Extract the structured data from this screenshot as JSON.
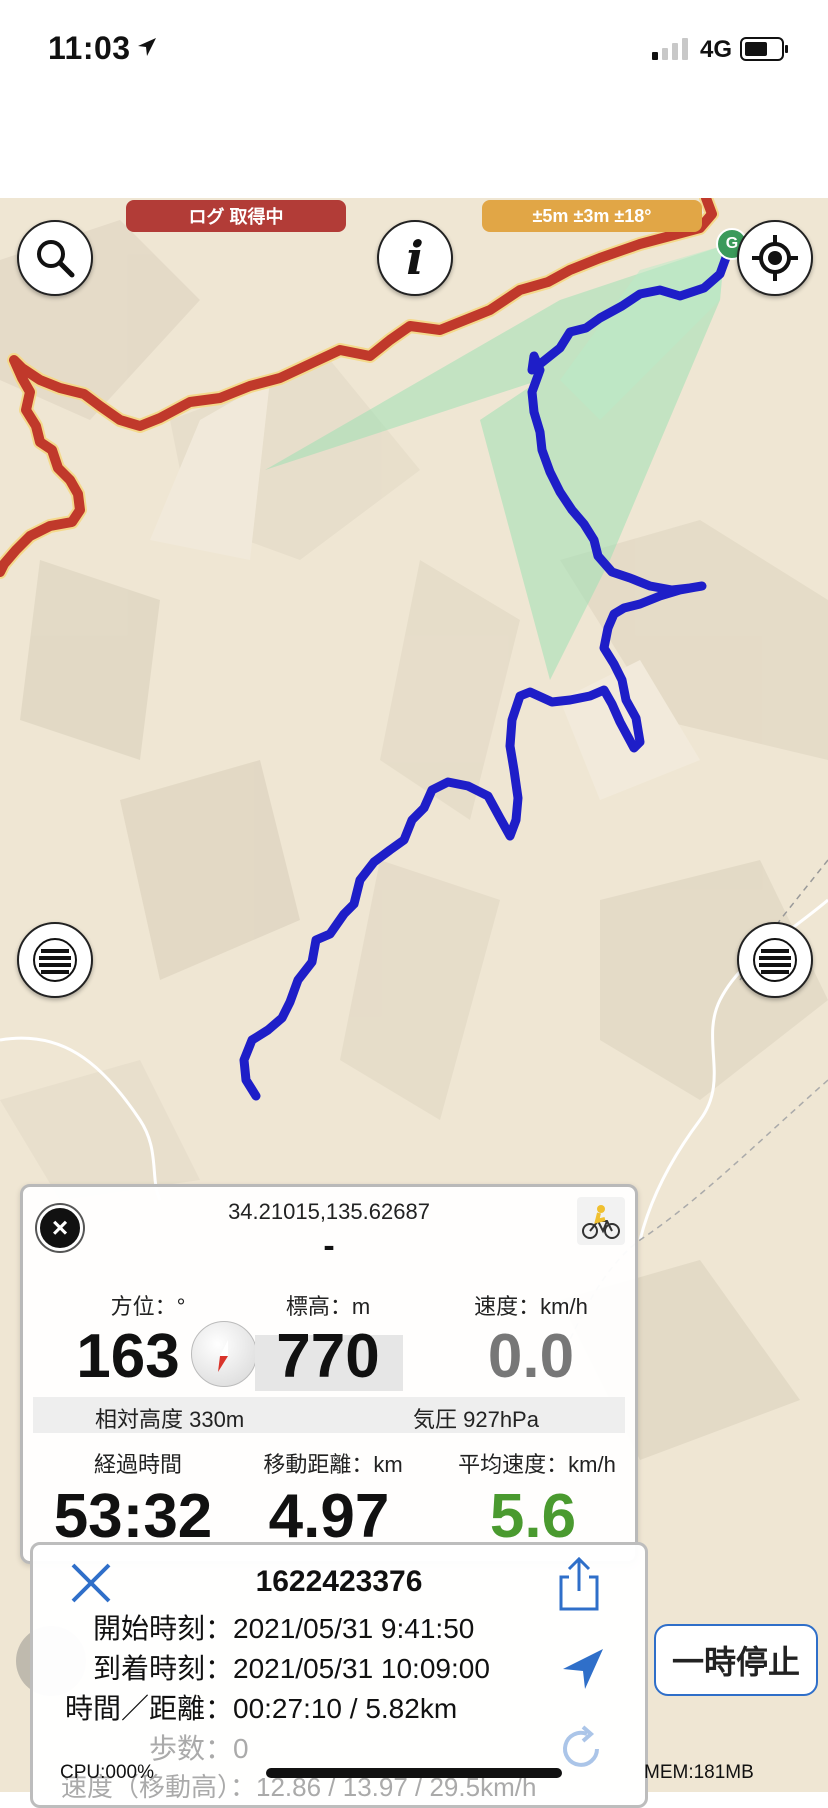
{
  "status_bar": {
    "time": "11:03",
    "network": "4G"
  },
  "map": {
    "log_status": "ログ 取得中",
    "accuracy": "±5m ±3m ±18°",
    "goal_marker": "G",
    "colors": {
      "red_route": "#c0392b",
      "blue_track": "#1e1ec8",
      "green_fan": "#9fe0b4",
      "terrain": "#efe6d3"
    }
  },
  "panel": {
    "coordinates": "34.21015,135.62687",
    "place": "-",
    "bearing_label": "方位：°",
    "bearing_value": "163",
    "altitude_label": "標高：m",
    "altitude_value": "770",
    "speed_label": "速度：km/h",
    "speed_value": "0.0",
    "relative_altitude": "相対高度 330m",
    "pressure": "気圧 927hPa",
    "elapsed_label": "経過時間",
    "elapsed_value": "53:32",
    "distance_label": "移動距離：km",
    "distance_value": "4.97",
    "avg_speed_label": "平均速度：km/h",
    "avg_speed_value": "5.6"
  },
  "log_card": {
    "id": "1622423376",
    "start_key": "開始時刻：",
    "start_value": "2021/05/31 9:41:50",
    "arrival_key": "到着時刻：",
    "arrival_value": "2021/05/31 10:09:00",
    "time_distance_key": "時間／距離：",
    "time_distance_value": "00:27:10 / 5.82km",
    "steps_key": "歩数：",
    "steps_value": "0",
    "speed_row": "速度（移動高）：12.86 / 13.97 / 29.5km/h"
  },
  "pause_button": "一時停止",
  "footer": {
    "cpu": "CPU:000%",
    "mem": "MEM:181MB"
  }
}
